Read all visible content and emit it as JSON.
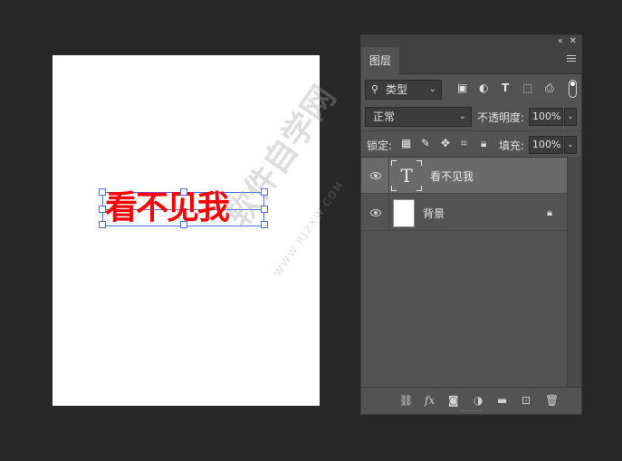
{
  "canvas": {
    "text_layer_content": "看不见我",
    "text_color": "#ff0000",
    "selection_color": "#4b6fd8"
  },
  "watermark": {
    "text": "软件自学网",
    "url": "WWW.RJZXW.COM"
  },
  "panel": {
    "collapse_icon": "double-chevron-icon",
    "close_icon": "close-icon",
    "tab_label": "图层",
    "filter": {
      "search_icon": "search-icon",
      "kind_label": "类型",
      "icons": [
        "image-filter-icon",
        "adjustment-filter-icon",
        "type-filter-icon",
        "shape-filter-icon",
        "smart-object-filter-icon"
      ]
    },
    "blend_mode": "正常",
    "opacity_label": "不透明度:",
    "opacity_value": "100%",
    "lock_label": "锁定:",
    "lock_icons": [
      "lock-transparent-icon",
      "lock-pixels-icon",
      "lock-position-icon",
      "lock-artboard-icon",
      "lock-all-icon"
    ],
    "fill_label": "填充:",
    "fill_value": "100%",
    "layers": [
      {
        "name": "看不见我",
        "type": "text",
        "thumb_glyph": "T",
        "selected": true,
        "visible": true
      },
      {
        "name": "背景",
        "type": "background",
        "selected": false,
        "visible": true,
        "locked": true
      }
    ],
    "bottom_icons": [
      "link-icon",
      "fx-icon",
      "mask-icon",
      "adjustment-icon",
      "folder-icon",
      "new-layer-icon",
      "trash-icon"
    ],
    "fx_label": "fx"
  }
}
